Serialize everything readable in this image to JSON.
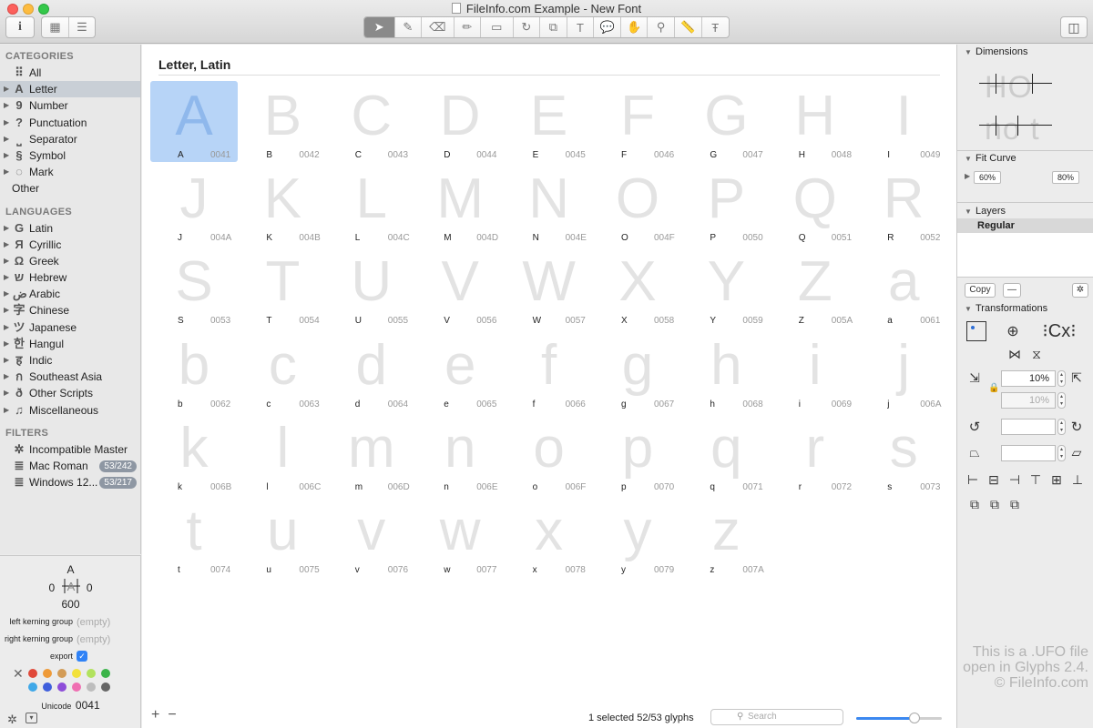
{
  "window": {
    "title": "FileInfo.com Example - New Font"
  },
  "toolbar": {
    "info_icon": "info-icon",
    "grid_view_icon": "grid-view-icon",
    "list_view_icon": "list-view-icon",
    "tools": [
      "select-tool",
      "draw-tool",
      "eraser-tool",
      "pencil-tool",
      "primitives-tool",
      "rotate-tool",
      "scale-tool",
      "text-tool",
      "annotation-tool",
      "hand-tool",
      "zoom-tool",
      "measure-tool",
      "type-tool"
    ],
    "sidebar_toggle_icon": "sidebar-toggle-icon"
  },
  "sidebar": {
    "categories_heading": "CATEGORIES",
    "categories": [
      {
        "label": "All",
        "glyph": "⠿",
        "has_arrow": false
      },
      {
        "label": "Letter",
        "glyph": "A",
        "has_arrow": true,
        "selected": true
      },
      {
        "label": "Number",
        "glyph": "9",
        "has_arrow": true
      },
      {
        "label": "Punctuation",
        "glyph": "?",
        "has_arrow": true
      },
      {
        "label": "Separator",
        "glyph": "⎵",
        "has_arrow": true
      },
      {
        "label": "Symbol",
        "glyph": "§",
        "has_arrow": true
      },
      {
        "label": "Mark",
        "glyph": "◌",
        "has_arrow": true
      },
      {
        "label": "Other",
        "glyph": "",
        "has_arrow": false,
        "no_indent": true
      }
    ],
    "languages_heading": "LANGUAGES",
    "languages": [
      {
        "label": "Latin",
        "glyph": "G"
      },
      {
        "label": "Cyrillic",
        "glyph": "Я"
      },
      {
        "label": "Greek",
        "glyph": "Ω"
      },
      {
        "label": "Hebrew",
        "glyph": "ש"
      },
      {
        "label": "Arabic",
        "glyph": "ض"
      },
      {
        "label": "Chinese",
        "glyph": "字"
      },
      {
        "label": "Japanese",
        "glyph": "ツ"
      },
      {
        "label": "Hangul",
        "glyph": "한"
      },
      {
        "label": "Indic",
        "glyph": "ह"
      },
      {
        "label": "Southeast Asia",
        "glyph": "ก"
      },
      {
        "label": "Other Scripts",
        "glyph": "ð"
      },
      {
        "label": "Miscellaneous",
        "glyph": "♫"
      }
    ],
    "filters_heading": "FILTERS",
    "filters": [
      {
        "label": "Incompatible Master",
        "glyph": "✲",
        "badge": ""
      },
      {
        "label": "Mac Roman",
        "glyph": "≣",
        "badge": "53/242"
      },
      {
        "label": "Windows 12...",
        "glyph": "≣",
        "badge": "53/217"
      }
    ]
  },
  "glyph_info": {
    "name": "A",
    "left_sidebearing": "0",
    "right_sidebearing": "0",
    "width": "600",
    "left_kerning_label": "left kerning group",
    "left_kerning_value": "(empty)",
    "right_kerning_label": "right kerning group",
    "right_kerning_value": "(empty)",
    "export_label": "export",
    "export_checked": true,
    "unicode_label": "Unicode",
    "unicode_value": "0041",
    "color_labels": [
      "#e0493a",
      "#ee9a38",
      "#d39c57",
      "#f2e13b",
      "#b2e25e",
      "#3cb44a",
      "#3fa8e8",
      "#3f5fdc",
      "#8e4dd9",
      "#ef6fb2",
      "#bdbdbd",
      "#666666"
    ]
  },
  "main": {
    "title": "Letter, Latin",
    "glyphs": [
      {
        "char": "A",
        "name": "A",
        "code": "0041",
        "selected": true
      },
      {
        "char": "B",
        "name": "B",
        "code": "0042"
      },
      {
        "char": "C",
        "name": "C",
        "code": "0043"
      },
      {
        "char": "D",
        "name": "D",
        "code": "0044"
      },
      {
        "char": "E",
        "name": "E",
        "code": "0045"
      },
      {
        "char": "F",
        "name": "F",
        "code": "0046"
      },
      {
        "char": "G",
        "name": "G",
        "code": "0047"
      },
      {
        "char": "H",
        "name": "H",
        "code": "0048"
      },
      {
        "char": "I",
        "name": "I",
        "code": "0049"
      },
      {
        "char": "J",
        "name": "J",
        "code": "004A"
      },
      {
        "char": "K",
        "name": "K",
        "code": "004B"
      },
      {
        "char": "L",
        "name": "L",
        "code": "004C"
      },
      {
        "char": "M",
        "name": "M",
        "code": "004D"
      },
      {
        "char": "N",
        "name": "N",
        "code": "004E"
      },
      {
        "char": "O",
        "name": "O",
        "code": "004F"
      },
      {
        "char": "P",
        "name": "P",
        "code": "0050"
      },
      {
        "char": "Q",
        "name": "Q",
        "code": "0051"
      },
      {
        "char": "R",
        "name": "R",
        "code": "0052"
      },
      {
        "char": "S",
        "name": "S",
        "code": "0053"
      },
      {
        "char": "T",
        "name": "T",
        "code": "0054"
      },
      {
        "char": "U",
        "name": "U",
        "code": "0055"
      },
      {
        "char": "V",
        "name": "V",
        "code": "0056"
      },
      {
        "char": "W",
        "name": "W",
        "code": "0057"
      },
      {
        "char": "X",
        "name": "X",
        "code": "0058"
      },
      {
        "char": "Y",
        "name": "Y",
        "code": "0059"
      },
      {
        "char": "Z",
        "name": "Z",
        "code": "005A"
      },
      {
        "char": "a",
        "name": "a",
        "code": "0061"
      },
      {
        "char": "b",
        "name": "b",
        "code": "0062"
      },
      {
        "char": "c",
        "name": "c",
        "code": "0063"
      },
      {
        "char": "d",
        "name": "d",
        "code": "0064"
      },
      {
        "char": "e",
        "name": "e",
        "code": "0065"
      },
      {
        "char": "f",
        "name": "f",
        "code": "0066"
      },
      {
        "char": "g",
        "name": "g",
        "code": "0067"
      },
      {
        "char": "h",
        "name": "h",
        "code": "0068"
      },
      {
        "char": "i",
        "name": "i",
        "code": "0069"
      },
      {
        "char": "j",
        "name": "j",
        "code": "006A"
      },
      {
        "char": "k",
        "name": "k",
        "code": "006B"
      },
      {
        "char": "l",
        "name": "l",
        "code": "006C"
      },
      {
        "char": "m",
        "name": "m",
        "code": "006D"
      },
      {
        "char": "n",
        "name": "n",
        "code": "006E"
      },
      {
        "char": "o",
        "name": "o",
        "code": "006F"
      },
      {
        "char": "p",
        "name": "p",
        "code": "0070"
      },
      {
        "char": "q",
        "name": "q",
        "code": "0071"
      },
      {
        "char": "r",
        "name": "r",
        "code": "0072"
      },
      {
        "char": "s",
        "name": "s",
        "code": "0073"
      },
      {
        "char": "t",
        "name": "t",
        "code": "0074"
      },
      {
        "char": "u",
        "name": "u",
        "code": "0075"
      },
      {
        "char": "v",
        "name": "v",
        "code": "0076"
      },
      {
        "char": "w",
        "name": "w",
        "code": "0077"
      },
      {
        "char": "x",
        "name": "x",
        "code": "0078"
      },
      {
        "char": "y",
        "name": "y",
        "code": "0079"
      },
      {
        "char": "z",
        "name": "z",
        "code": "007A"
      }
    ],
    "status": "1 selected 52/53 glyphs",
    "search_placeholder": "Search",
    "zoom_fraction": 0.68
  },
  "right_panel": {
    "dimensions_heading": "Dimensions",
    "dim_preview_top": "HO",
    "dim_preview_bottom": "no t",
    "fit_curve_heading": "Fit Curve",
    "fit_curve_min": "60%",
    "fit_curve_max": "80%",
    "layers_heading": "Layers",
    "layer_name": "Regular",
    "copy_button": "Copy",
    "minus_button": "—",
    "gear_icon": "gear-icon",
    "transformations_heading": "Transformations",
    "scale_value": "10%",
    "scale_value_2": "10%",
    "watermark": "This is a .UFO file open in Glyphs 2.4. © FileInfo.com"
  }
}
